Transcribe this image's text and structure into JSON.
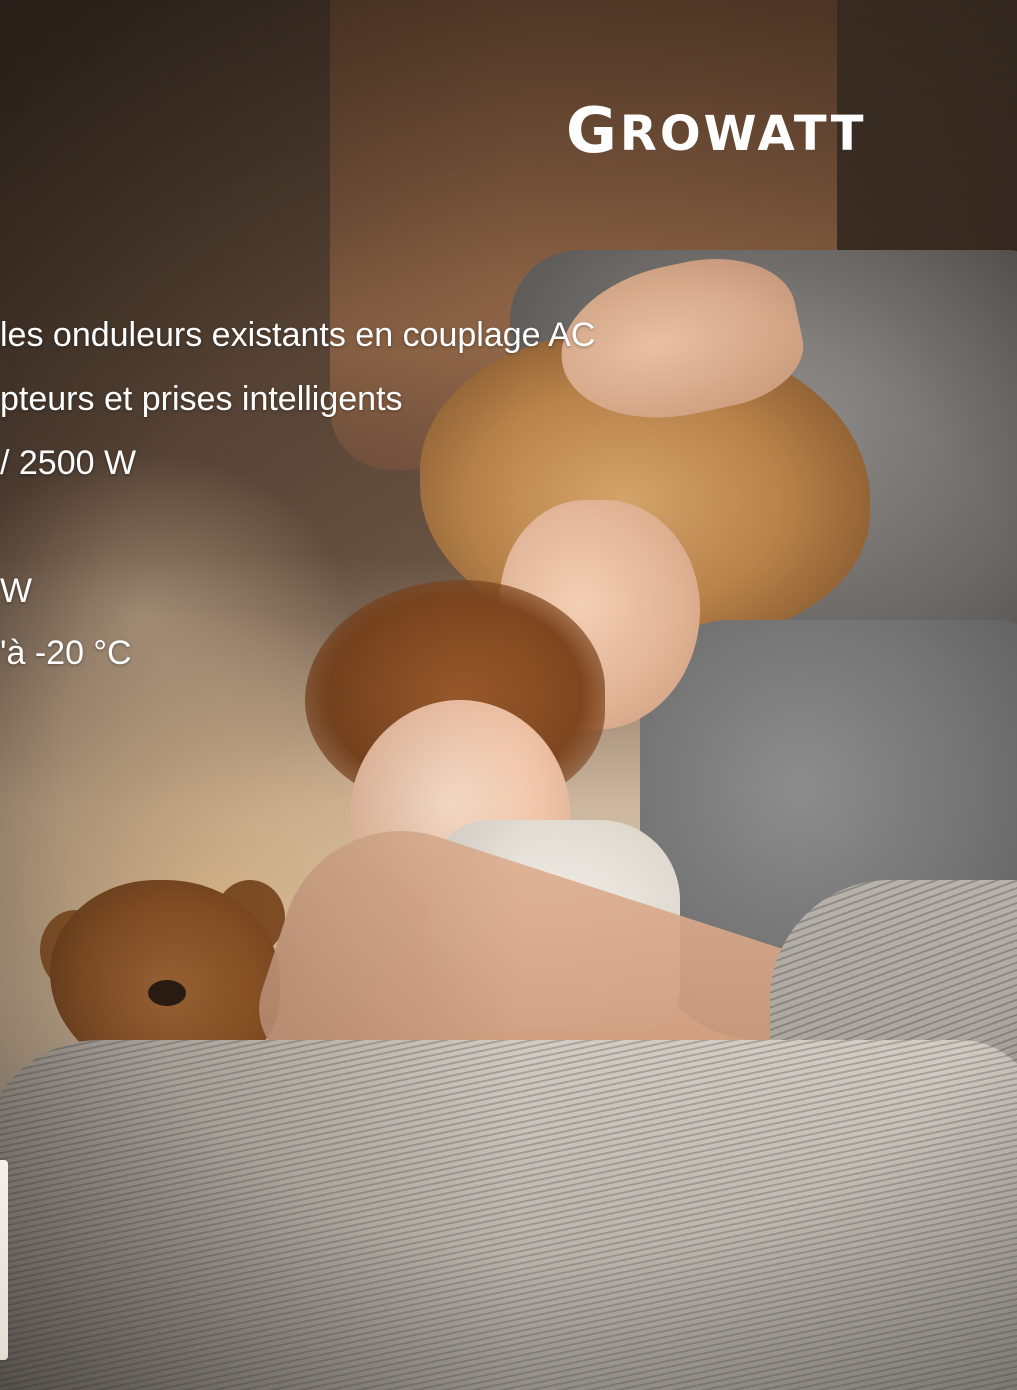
{
  "brand": {
    "logo_initial": "G",
    "logo_rest": "ROWATT"
  },
  "features": [
    "les onduleurs existants en couplage AC",
    "pteurs et prises intelligents",
    "/ 2500 W",
    "W",
    "'à -20 °C"
  ],
  "colors": {
    "overlay_text": "#ffffff",
    "pillow": "#6e6b68",
    "headboard": "#855c3f"
  }
}
